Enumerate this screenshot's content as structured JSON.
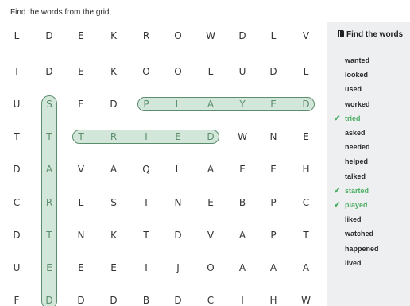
{
  "instruction": "Find the words from the grid",
  "grid": {
    "rows": [
      [
        "L",
        "D",
        "E",
        "K",
        "R",
        "O",
        "W",
        "D",
        "L",
        "V"
      ],
      [
        "T",
        "D",
        "E",
        "K",
        "O",
        "O",
        "L",
        "U",
        "D",
        "L"
      ],
      [
        "U",
        "S",
        "E",
        "D",
        "P",
        "L",
        "A",
        "Y",
        "E",
        "D"
      ],
      [
        "T",
        "T",
        "T",
        "R",
        "I",
        "E",
        "D",
        "W",
        "N",
        "E"
      ],
      [
        "D",
        "A",
        "V",
        "A",
        "Q",
        "L",
        "A",
        "E",
        "E",
        "H"
      ],
      [
        "C",
        "R",
        "L",
        "S",
        "I",
        "N",
        "E",
        "B",
        "P",
        "C"
      ],
      [
        "D",
        "T",
        "N",
        "K",
        "T",
        "D",
        "V",
        "A",
        "P",
        "T"
      ],
      [
        "U",
        "E",
        "E",
        "E",
        "I",
        "J",
        "O",
        "A",
        "A",
        "A"
      ],
      [
        "F",
        "D",
        "D",
        "D",
        "B",
        "D",
        "C",
        "I",
        "H",
        "W"
      ]
    ],
    "found": [
      {
        "word": "played",
        "row": 2,
        "col": 4,
        "direction": "horizontal",
        "length": 6
      },
      {
        "word": "tried",
        "row": 3,
        "col": 2,
        "direction": "horizontal",
        "length": 5
      },
      {
        "word": "started",
        "row": 2,
        "col": 1,
        "direction": "vertical",
        "length": 7
      }
    ],
    "highlight_color": "#7eba92"
  },
  "word_panel": {
    "title": "Find the words",
    "icon": "book-icon",
    "check_icon_char": "✔",
    "found_color": "#4cae64",
    "words": [
      {
        "label": "wanted",
        "found": false
      },
      {
        "label": "looked",
        "found": false
      },
      {
        "label": "used",
        "found": false
      },
      {
        "label": "worked",
        "found": false
      },
      {
        "label": "tried",
        "found": true
      },
      {
        "label": "asked",
        "found": false
      },
      {
        "label": "needed",
        "found": false
      },
      {
        "label": "helped",
        "found": false
      },
      {
        "label": "talked",
        "found": false
      },
      {
        "label": "started",
        "found": true
      },
      {
        "label": "played",
        "found": true
      },
      {
        "label": "liked",
        "found": false
      },
      {
        "label": "watched",
        "found": false
      },
      {
        "label": "happened",
        "found": false
      },
      {
        "label": "lived",
        "found": false
      }
    ]
  }
}
